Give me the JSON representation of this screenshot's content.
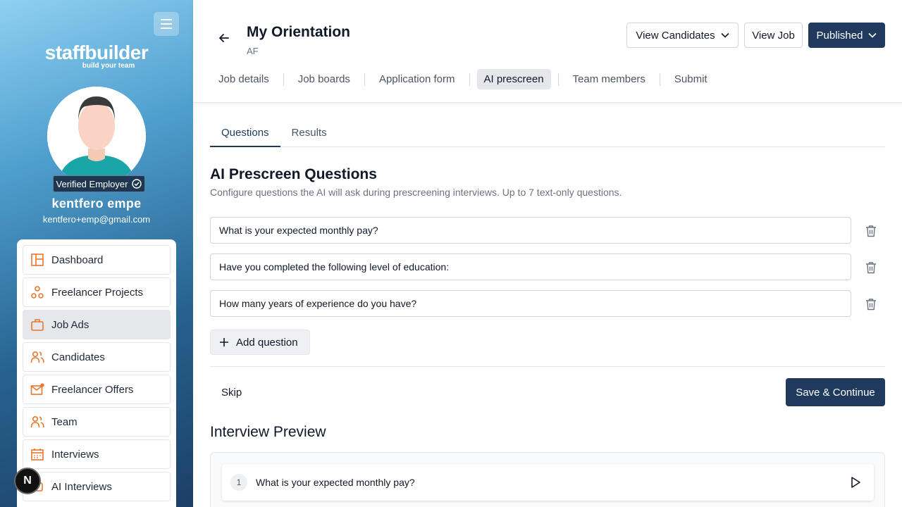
{
  "sidebar": {
    "logo_main": "staffbuilder",
    "logo_tagline": "build your team",
    "verified_label": "Verified Employer",
    "user_name": "kentfero empe",
    "user_email": "kentfero+emp@gmail.com",
    "items": [
      {
        "label": "Dashboard",
        "icon": "layout-icon"
      },
      {
        "label": "Freelancer Projects",
        "icon": "projects-icon"
      },
      {
        "label": "Job Ads",
        "icon": "briefcase-icon",
        "active": true
      },
      {
        "label": "Candidates",
        "icon": "users-icon"
      },
      {
        "label": "Freelancer Offers",
        "icon": "mail-icon"
      },
      {
        "label": "Team",
        "icon": "team-icon"
      },
      {
        "label": "Interviews",
        "icon": "calendar-icon"
      },
      {
        "label": "AI Interviews",
        "icon": "ai-icon"
      }
    ],
    "badge_letter": "N"
  },
  "header": {
    "title": "My Orientation",
    "subtitle": "AF",
    "view_candidates": "View Candidates",
    "view_job": "View Job",
    "status": "Published",
    "tabs": [
      {
        "label": "Job details"
      },
      {
        "label": "Job boards"
      },
      {
        "label": "Application form"
      },
      {
        "label": "AI prescreen",
        "active": true
      },
      {
        "label": "Team members"
      },
      {
        "label": "Submit"
      }
    ]
  },
  "main": {
    "subtabs": [
      {
        "label": "Questions",
        "active": true
      },
      {
        "label": "Results"
      }
    ],
    "section_title": "AI Prescreen Questions",
    "section_desc": "Configure questions the AI will ask during prescreening interviews. Up to 7 text-only questions.",
    "questions": [
      "What is your expected monthly pay?",
      "Have you completed the following level of education:",
      "How many years of experience do you have?"
    ],
    "add_question": "Add question",
    "skip": "Skip",
    "save": "Save & Continue",
    "preview_title": "Interview Preview",
    "preview_items": [
      {
        "num": "1",
        "text": "What is your expected monthly pay?"
      }
    ]
  },
  "colors": {
    "accent": "#1f3a5c",
    "icon_orange": "#e8772e"
  }
}
